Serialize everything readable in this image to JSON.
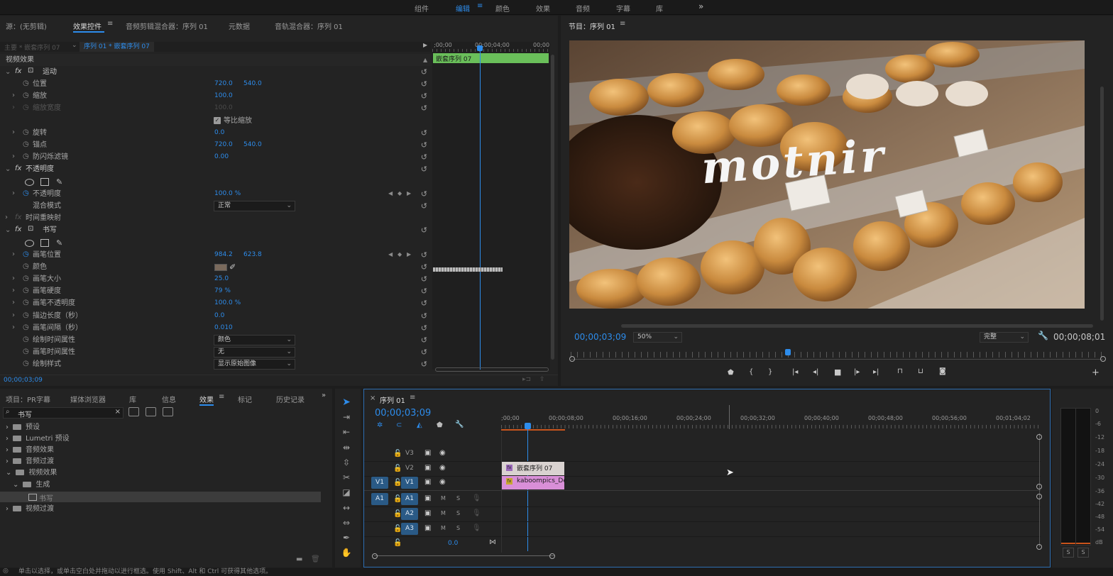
{
  "workspaces": {
    "items": [
      "组件",
      "编辑",
      "颜色",
      "效果",
      "音频",
      "字幕",
      "库"
    ],
    "active_index": 1,
    "more": "»"
  },
  "source_panel": {
    "tabs": [
      "源：(无剪辑)",
      "效果控件",
      "音频剪辑混合器：序列 01",
      "元数据",
      "音轨混合器：序列 01"
    ],
    "active_tab": "效果控件",
    "master_label": "主要 * 嵌套序列 07",
    "sequence_clip": "序列 01 * 嵌套序列 07",
    "mini_times": [
      ";00;00",
      "00;00;04;00",
      "00;00"
    ],
    "mini_clip_label": "嵌套序列 07",
    "video_effects_heading": "视频效果",
    "motion": {
      "name": "运动",
      "position_label": "位置",
      "position_x": "720.0",
      "position_y": "540.0",
      "scale_label": "缩放",
      "scale": "100.0",
      "scale_width_label": "缩放宽度",
      "scale_width": "100.0",
      "uniform_scale_label": "等比缩放",
      "rotation_label": "旋转",
      "rotation": "0.0",
      "anchor_label": "锚点",
      "anchor_x": "720.0",
      "anchor_y": "540.0",
      "antiflicker_label": "防闪烁滤镜",
      "antiflicker": "0.00"
    },
    "opacity": {
      "name": "不透明度",
      "opacity_label": "不透明度",
      "opacity": "100.0 %",
      "blend_label": "混合模式",
      "blend_mode": "正常"
    },
    "time_remap": "时间重映射",
    "write_on": {
      "name": "书写",
      "brush_position_label": "画笔位置",
      "brush_x": "984.2",
      "brush_y": "623.8",
      "color_label": "颜色",
      "brush_size_label": "画笔大小",
      "brush_size": "25.0",
      "brush_hardness_label": "画笔硬度",
      "brush_hardness": "79 %",
      "brush_opacity_label": "画笔不透明度",
      "brush_opacity": "100.0 %",
      "stroke_length_label": "描边长度（秒）",
      "stroke_length": "0.0",
      "brush_spacing_label": "画笔间隔（秒）",
      "brush_spacing": "0.010",
      "paint_time_label": "绘制时间属性",
      "paint_time": "颜色",
      "brush_time_label": "画笔时间属性",
      "brush_time": "无",
      "paint_style_label": "绘制样式",
      "paint_style": "显示原始图像"
    },
    "footer_time": "00;00;03;09"
  },
  "program_monitor": {
    "title": "节目：序列 01",
    "overlay_text": "motnir",
    "timecode": "00;00;03;09",
    "zoom": "50%",
    "quality": "完整",
    "duration": "00;00;08;01"
  },
  "project_panel": {
    "tabs": [
      "项目：PR字幕",
      "媒体浏览器",
      "库",
      "信息",
      "效果",
      "标记",
      "历史记录"
    ],
    "active_tab": "效果",
    "search_value": "书写",
    "tree": [
      "预设",
      "Lumetri 预设",
      "音频效果",
      "音频过渡",
      "视频效果",
      "生成",
      "书写",
      "视频过渡"
    ]
  },
  "timeline": {
    "title": "序列 01",
    "timecode": "00;00;03;09",
    "ruler": [
      ";00;00",
      "00;00;08;00",
      "00;00;16;00",
      "00;00;24;00",
      "00;00;32;00",
      "00;00;40;00",
      "00;00;48;00",
      "00;00;56;00",
      "00;01;04;02"
    ],
    "video_tracks": [
      "V3",
      "V2",
      "V1"
    ],
    "audio_tracks": [
      "A1",
      "A2",
      "A3"
    ],
    "src_v": "V1",
    "src_a": "A1",
    "mute": "M",
    "solo": "S",
    "master_value": "0.0",
    "clip_nested": "嵌套序列 07",
    "clip_video": "kaboompics_De"
  },
  "meter": {
    "scale": [
      "0",
      "-6",
      "-12",
      "-18",
      "-24",
      "-30",
      "-36",
      "-42",
      "-48",
      "-54",
      "dB"
    ],
    "solo_buttons": [
      "S",
      "S"
    ]
  },
  "status_bar": "单击以选择，或单击空白处并拖动以进行框选。使用 Shift、Alt 和 Ctrl 可获得其他选项。",
  "colors": {
    "accent": "#2d8ceb",
    "clip_green": "#6abf5a",
    "clip_pink": "#d98fd8"
  }
}
